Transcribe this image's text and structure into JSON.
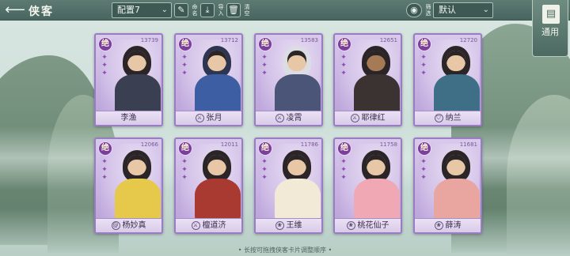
{
  "header": {
    "back_icon": "arrow-left-icon",
    "title": "侠客",
    "config_select": "配置7",
    "tools": {
      "edit": {
        "label": "命名",
        "icon": "pencil-icon"
      },
      "import": {
        "label": "导入",
        "icon": "download-icon"
      },
      "clear": {
        "label": "清空",
        "icon": "trash-icon"
      },
      "filter": {
        "label": "筛选",
        "icon": "eye-icon"
      }
    },
    "sort_select": "默认",
    "side_tab": {
      "label": "通用",
      "icon": "book-icon"
    }
  },
  "cards": [
    {
      "name": "李渔",
      "rank": "绝",
      "power": "13739",
      "class_icon": ""
    },
    {
      "name": "张月",
      "rank": "绝",
      "power": "13712",
      "class_icon": "sword-class-icon"
    },
    {
      "name": "凌霄",
      "rank": "绝",
      "power": "13583",
      "class_icon": "sword-class-icon"
    },
    {
      "name": "耶律红",
      "rank": "绝",
      "power": "12651",
      "class_icon": "sword-class-icon"
    },
    {
      "name": "纳兰",
      "rank": "绝",
      "power": "12720",
      "class_icon": "shield-class-icon"
    },
    {
      "name": "杨妙真",
      "rank": "绝",
      "power": "12066",
      "class_icon": "spiral-class-icon"
    },
    {
      "name": "檀道济",
      "rank": "绝",
      "power": "12011",
      "class_icon": "sword-class-icon"
    },
    {
      "name": "王维",
      "rank": "绝",
      "power": "11786",
      "class_icon": "lotus-class-icon"
    },
    {
      "name": "桃花仙子",
      "rank": "绝",
      "power": "11758",
      "class_icon": "lotus-class-icon"
    },
    {
      "name": "薛涛",
      "rank": "绝",
      "power": "11681",
      "class_icon": "lotus-class-icon"
    }
  ],
  "footer_hint": "• 长按可拖拽侠客卡片调整顺序 •",
  "colors": {
    "header_bg": "#486560",
    "card_border": "#9a7cc3",
    "card_bg": "#c5b0e0",
    "rank_badge": "#7a3f9a"
  }
}
